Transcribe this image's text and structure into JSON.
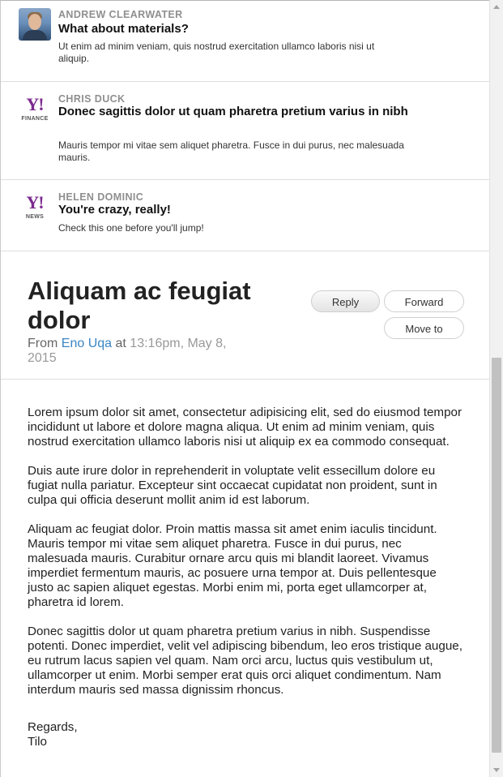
{
  "messages": [
    {
      "sender": "Andrew Clearwater",
      "subject": "What about materials?",
      "snippet": "Ut enim ad minim veniam, quis nostrud exercitation ullamco laboris nisi ut aliquip."
    },
    {
      "sender": "Chris Duck",
      "subject": "Donec sagittis dolor ut quam pharetra pretium varius in nibh",
      "snippet": "Mauris tempor mi vitae sem aliquet pharetra. Fusce in dui purus, nec malesuada mauris.",
      "icon_text": "Y!",
      "icon_sub": "FINANCE"
    },
    {
      "sender": "Helen Dominic",
      "subject": "You're crazy, really!",
      "snippet": "Check this one before you'll jump!",
      "icon_text": "Y!",
      "icon_sub": "NEWS"
    }
  ],
  "mail": {
    "title": "Aliquam ac feugiat dolor",
    "from_label": "From",
    "from_name": "Eno Uqa",
    "at_label": "at",
    "date": "13:16pm, May 8, 2015",
    "buttons": {
      "reply": "Reply",
      "forward": "Forward",
      "move_to": "Move to"
    },
    "paragraphs": [
      "Lorem ipsum dolor sit amet, consectetur adipisicing elit, sed do eiusmod tempor incididunt ut labore et dolore magna aliqua. Ut enim ad minim veniam, quis nostrud exercitation ullamco laboris nisi ut aliquip ex ea commodo consequat.",
      "Duis aute irure dolor in reprehenderit in voluptate velit essecillum dolore eu fugiat nulla pariatur. Excepteur sint occaecat cupidatat non proident, sunt in culpa qui officia deserunt mollit anim id est laborum.",
      "Aliquam ac feugiat dolor. Proin mattis massa sit amet enim iaculis tincidunt. Mauris tempor mi vitae sem aliquet pharetra. Fusce in dui purus, nec malesuada mauris. Curabitur ornare arcu quis mi blandit laoreet. Vivamus imperdiet fermentum mauris, ac posuere urna tempor at. Duis pellentesque justo ac sapien aliquet egestas. Morbi enim mi, porta eget ullamcorper at, pharetra id lorem.",
      "Donec sagittis dolor ut quam pharetra pretium varius in nibh. Suspendisse potenti. Donec imperdiet, velit vel adipiscing bibendum, leo eros tristique augue, eu rutrum lacus sapien vel quam. Nam orci arcu, luctus quis vestibulum ut, ullamcorper ut enim. Morbi semper erat quis orci aliquet condimentum. Nam interdum mauris sed massa dignissim rhoncus."
    ],
    "signoff": "Regards,",
    "signature": "Tilo"
  },
  "colors": {
    "link": "#3b86c4",
    "yahoo_purple": "#7b2a8f"
  },
  "icons": [
    "user-photo-icon",
    "yahoo-finance-icon",
    "yahoo-news-icon"
  ]
}
